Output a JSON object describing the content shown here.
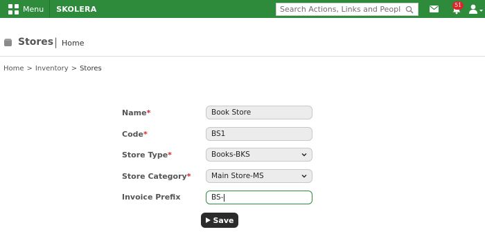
{
  "topbar": {
    "menu_label": "Menu",
    "brand": "SKOLERA",
    "search_placeholder": "Search Actions, Links and People",
    "notification_count": "51",
    "color": "#2e8b3c"
  },
  "header": {
    "title": "Stores",
    "separator": "|",
    "subtitle": "Home"
  },
  "breadcrumb": {
    "items": [
      "Home",
      ">",
      "Inventory",
      ">",
      "Stores"
    ]
  },
  "form": {
    "name": {
      "label": "Name",
      "required": "*",
      "value": "Book Store"
    },
    "code": {
      "label": "Code",
      "required": "*",
      "value": "BS1"
    },
    "store_type": {
      "label": "Store Type",
      "required": "*",
      "value": "Books-BKS"
    },
    "store_category": {
      "label": "Store Category",
      "required": "*",
      "value": "Main Store-MS"
    },
    "invoice_prefix": {
      "label": "Invoice Prefix",
      "value": "BS-"
    },
    "save_label": "Save"
  }
}
